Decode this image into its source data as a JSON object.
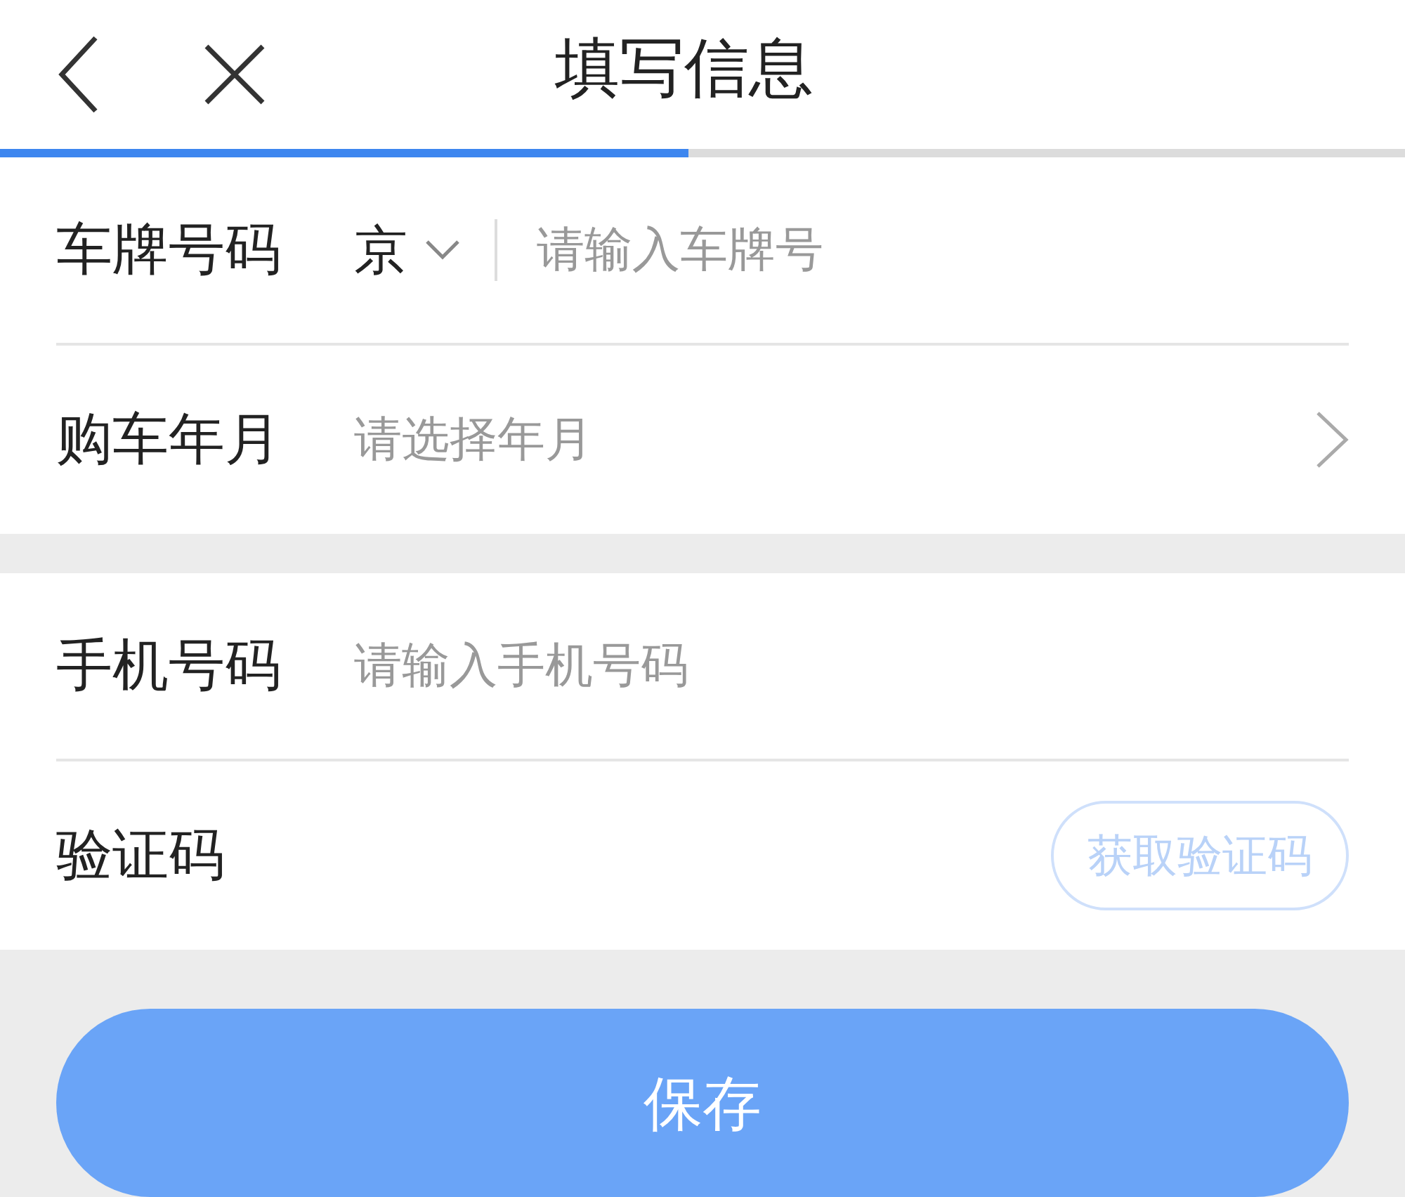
{
  "header": {
    "title": "填写信息"
  },
  "progress": {
    "level": 0.49
  },
  "section_1": [
    {
      "kind": "plate",
      "label": "车牌号码",
      "province": "京",
      "placeholder": "请输入车牌号"
    },
    {
      "kind": "picker",
      "label": "购车年月",
      "placeholder": "请选择年月"
    }
  ],
  "section_2": [
    {
      "kind": "input",
      "label": "手机号码",
      "placeholder": "请输入手机号码"
    },
    {
      "kind": "code",
      "label": "验证码",
      "button": "获取验证码",
      "disabled": true
    }
  ],
  "save_button": "保存"
}
